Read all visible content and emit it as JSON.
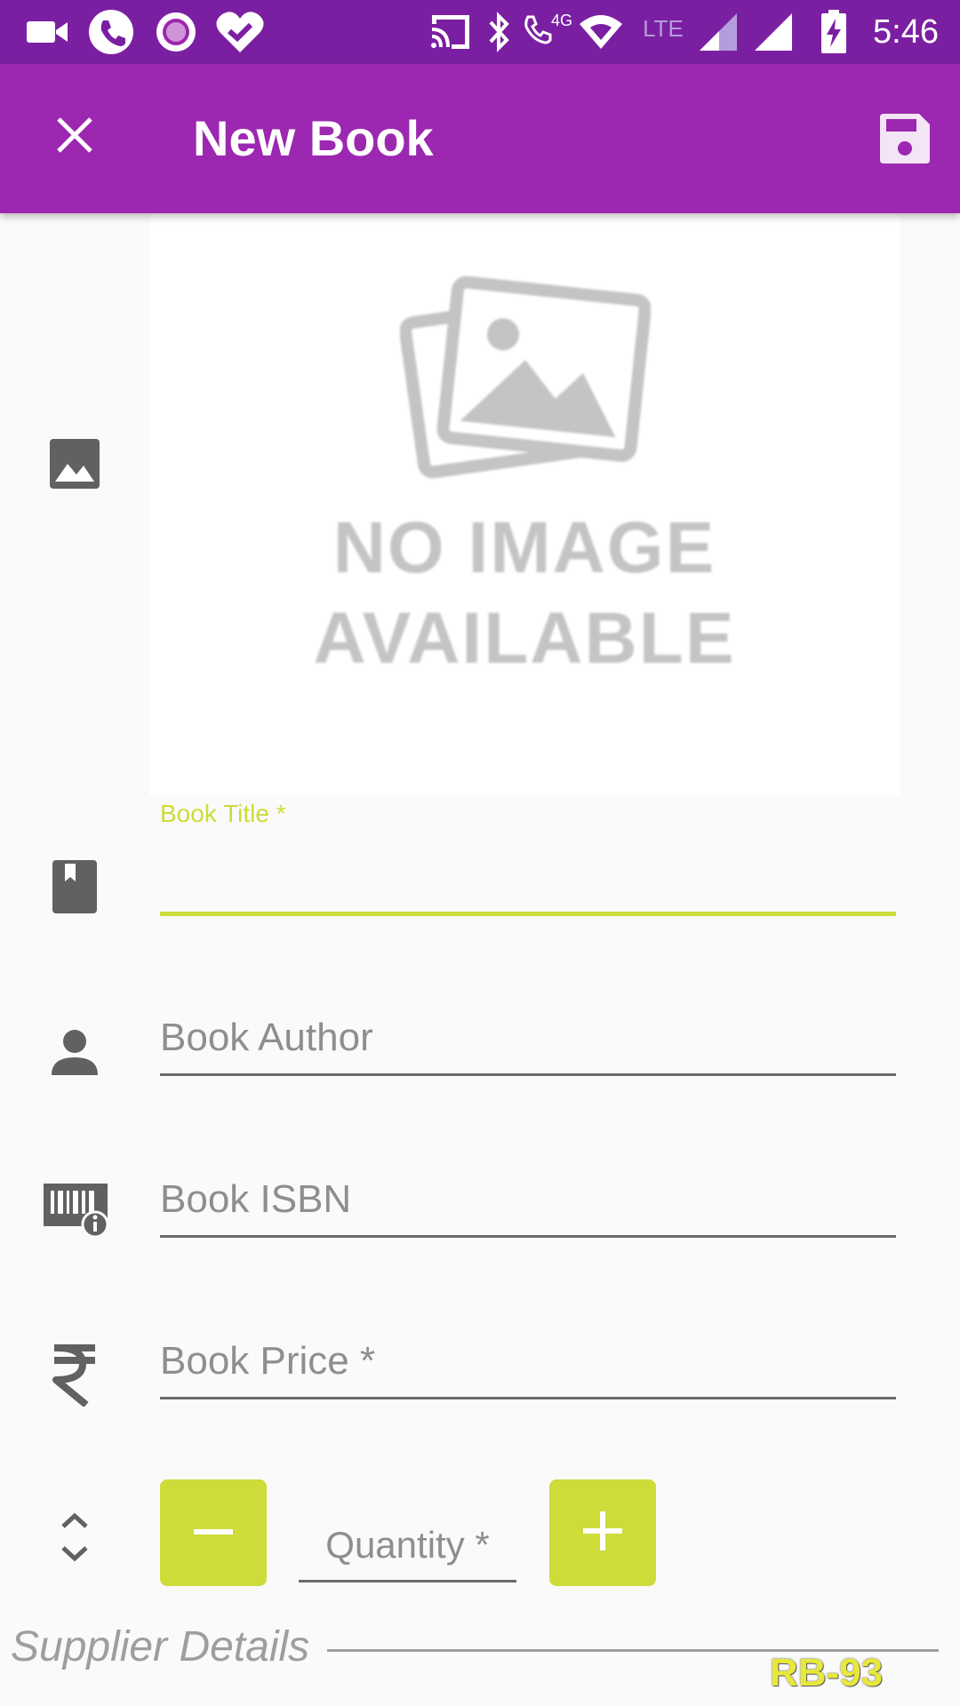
{
  "status_bar": {
    "time": "5:46",
    "network_label": "4G",
    "lte_label": "LTE",
    "icons": [
      "video-call-icon",
      "phone-icon",
      "record-icon",
      "heart-check-icon",
      "cast-icon",
      "bluetooth-icon",
      "volte-call-icon",
      "wifi-icon",
      "signal-icon",
      "signal-icon",
      "battery-charging-icon"
    ]
  },
  "toolbar": {
    "title": "New Book",
    "close_icon": "close-icon",
    "save_icon": "save-icon"
  },
  "image": {
    "placeholder_line1": "NO IMAGE",
    "placeholder_line2": "AVAILABLE",
    "row_icon": "image-icon"
  },
  "form": {
    "title": {
      "label": "Book Title *",
      "value": "",
      "icon": "book-icon"
    },
    "author": {
      "placeholder": "Book Author",
      "value": "",
      "icon": "person-icon"
    },
    "isbn": {
      "placeholder": "Book ISBN",
      "value": "",
      "icon": "barcode-info-icon"
    },
    "price": {
      "placeholder": "Book Price *",
      "value": "",
      "icon": "rupee-icon"
    },
    "quantity": {
      "placeholder": "Quantity *",
      "value": "",
      "icon": "unfold-icon"
    }
  },
  "supplier": {
    "label": "Supplier Details"
  },
  "watermark": "RB-93",
  "colors": {
    "status_bar": "#7b1fa2",
    "toolbar": "#9c27b0",
    "accent": "#cddc39",
    "icon_gray": "#616161",
    "background": "#fafafa"
  }
}
